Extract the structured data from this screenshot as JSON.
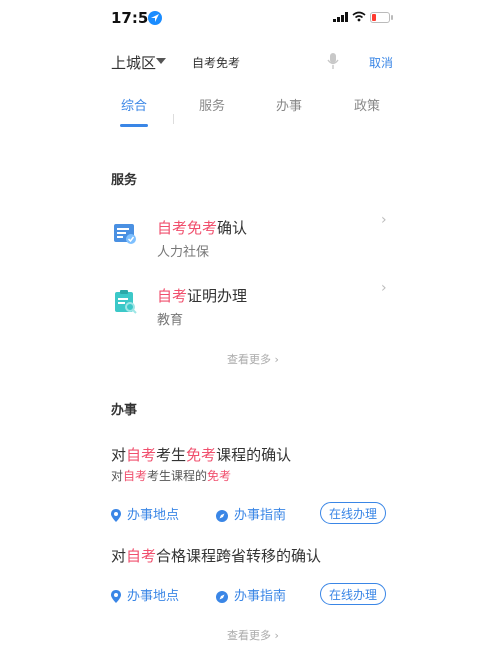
{
  "status_bar": {
    "time": "17:50"
  },
  "search": {
    "region": "上城区",
    "query": "自考免考",
    "cancel_label": "取消"
  },
  "tabs": [
    {
      "label": "综合",
      "active": true
    },
    {
      "label": "服务",
      "active": false
    },
    {
      "label": "办事",
      "active": false
    },
    {
      "label": "政策",
      "active": false
    }
  ],
  "services": {
    "title": "服务",
    "items": [
      {
        "title_hl1": "自考",
        "title_hl2": "免考",
        "title_rest": "确认",
        "subtitle": "人力社保"
      },
      {
        "title_hl1": "自考",
        "title_rest": "证明办理",
        "subtitle": "教育"
      }
    ],
    "more_label": "查看更多 ›"
  },
  "affairs": {
    "title": "办事",
    "items": [
      {
        "title": {
          "p1": "对",
          "hl1": "自考",
          "p2": "考生",
          "hl2": "免考",
          "p3": "课程的确认"
        },
        "subtitle": {
          "p1": "对",
          "hl1": "自考",
          "p2": "考生课程的",
          "hl2": "免考"
        }
      },
      {
        "title": {
          "p1": "对",
          "hl1": "自考",
          "p2": "合格课程跨省转移的确认"
        }
      }
    ],
    "actions": {
      "location": "办事地点",
      "guide": "办事指南",
      "online": "在线办理"
    },
    "more_label": "查看更多 ›"
  },
  "colors": {
    "accent": "#3a86e6",
    "highlight": "#f0506e"
  }
}
